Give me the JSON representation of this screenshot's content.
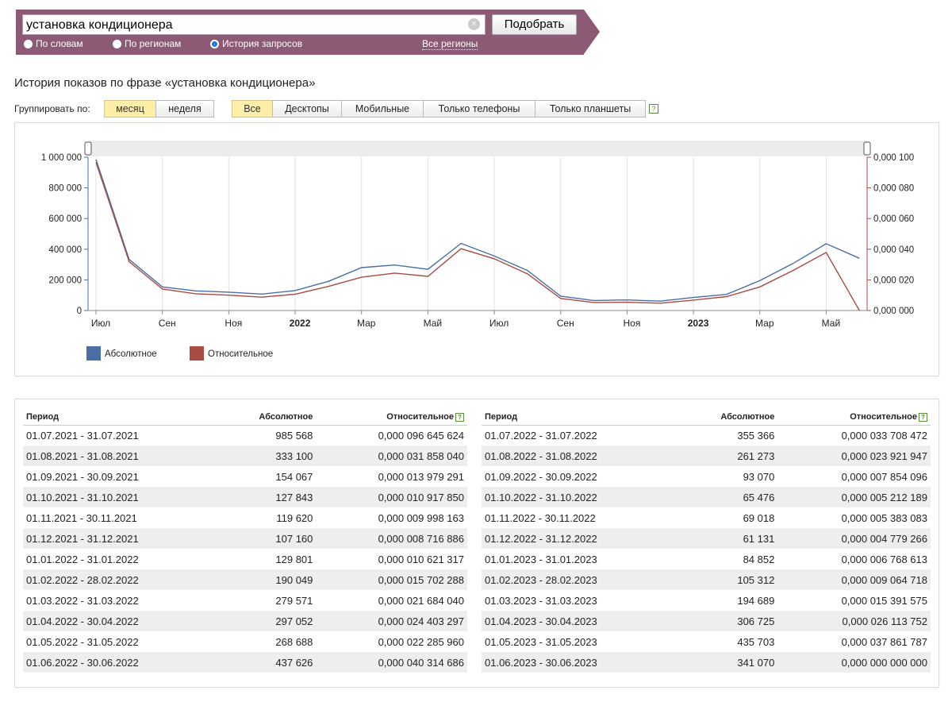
{
  "search": {
    "query": "установка кондиционера",
    "clear_icon": "clear-icon",
    "submit_label": "Подобрать",
    "modes": [
      {
        "label": "По словам",
        "selected": false
      },
      {
        "label": "По регионам",
        "selected": false
      },
      {
        "label": "История запросов",
        "selected": true
      }
    ],
    "regions_link": "Все регионы"
  },
  "page_title": "История показов по фразе «установка кондиционера»",
  "grouping": {
    "label": "Группировать по:",
    "options": [
      "месяц",
      "неделя"
    ],
    "selected": "месяц"
  },
  "devices": {
    "options": [
      "Все",
      "Десктопы",
      "Мобильные",
      "Только телефоны",
      "Только планшеты"
    ],
    "selected": "Все",
    "help_icon": "?"
  },
  "colors": {
    "header_bg": "#8c5a74",
    "absolute": "#4a6fa5",
    "relative": "#a84b43",
    "active_segment": "#fdeea8"
  },
  "chart_data": {
    "type": "line",
    "x_labels": [
      "Июл",
      "Сен",
      "Ноя",
      "2022",
      "Мар",
      "Май",
      "Июл",
      "Сен",
      "Ноя",
      "2023",
      "Мар",
      "Май"
    ],
    "left_axis_ticks": [
      "1 000 000",
      "800 000",
      "600 000",
      "400 000",
      "200 000",
      "0"
    ],
    "right_axis_ticks": [
      "0,000 100",
      "0,000 080",
      "0,000 060",
      "0,000 040",
      "0,000 020",
      "0,000 000"
    ],
    "left_ylim": [
      0,
      1000000
    ],
    "right_ylim": [
      0,
      0.0001
    ],
    "series": [
      {
        "name": "Абсолютное",
        "axis": "left",
        "values": [
          985568,
          333100,
          154067,
          127843,
          119620,
          107160,
          129801,
          190049,
          279571,
          297052,
          268688,
          437626,
          355366,
          261273,
          93070,
          65476,
          69018,
          61131,
          84852,
          105312,
          194689,
          306725,
          435703,
          341070
        ]
      },
      {
        "name": "Относительное",
        "axis": "right",
        "values": [
          9.6645624e-05,
          3.185804e-05,
          1.3979291e-05,
          1.091785e-05,
          9.998163e-06,
          8.716886e-06,
          1.0621317e-05,
          1.5702288e-05,
          2.168404e-05,
          2.4403297e-05,
          2.228596e-05,
          4.0314686e-05,
          3.3708472e-05,
          2.3921947e-05,
          7.854096e-06,
          5.212189e-06,
          5.383083e-06,
          4.779266e-06,
          6.768613e-06,
          9.064718e-06,
          1.5391575e-05,
          2.6113752e-05,
          3.7861787e-05,
          0.0
        ]
      }
    ]
  },
  "table": {
    "headers": {
      "period": "Период",
      "absolute": "Абсолютное",
      "relative": "Относительное"
    },
    "left_rows": [
      {
        "period": "01.07.2021 - 31.07.2021",
        "absolute": "985 568",
        "relative": "0,000 096 645 624"
      },
      {
        "period": "01.08.2021 - 31.08.2021",
        "absolute": "333 100",
        "relative": "0,000 031 858 040"
      },
      {
        "period": "01.09.2021 - 30.09.2021",
        "absolute": "154 067",
        "relative": "0,000 013 979 291"
      },
      {
        "period": "01.10.2021 - 31.10.2021",
        "absolute": "127 843",
        "relative": "0,000 010 917 850"
      },
      {
        "period": "01.11.2021 - 30.11.2021",
        "absolute": "119 620",
        "relative": "0,000 009 998 163"
      },
      {
        "period": "01.12.2021 - 31.12.2021",
        "absolute": "107 160",
        "relative": "0,000 008 716 886"
      },
      {
        "period": "01.01.2022 - 31.01.2022",
        "absolute": "129 801",
        "relative": "0,000 010 621 317"
      },
      {
        "period": "01.02.2022 - 28.02.2022",
        "absolute": "190 049",
        "relative": "0,000 015 702 288"
      },
      {
        "period": "01.03.2022 - 31.03.2022",
        "absolute": "279 571",
        "relative": "0,000 021 684 040"
      },
      {
        "period": "01.04.2022 - 30.04.2022",
        "absolute": "297 052",
        "relative": "0,000 024 403 297"
      },
      {
        "period": "01.05.2022 - 31.05.2022",
        "absolute": "268 688",
        "relative": "0,000 022 285 960"
      },
      {
        "period": "01.06.2022 - 30.06.2022",
        "absolute": "437 626",
        "relative": "0,000 040 314 686"
      }
    ],
    "right_rows": [
      {
        "period": "01.07.2022 - 31.07.2022",
        "absolute": "355 366",
        "relative": "0,000 033 708 472"
      },
      {
        "period": "01.08.2022 - 31.08.2022",
        "absolute": "261 273",
        "relative": "0,000 023 921 947"
      },
      {
        "period": "01.09.2022 - 30.09.2022",
        "absolute": "93 070",
        "relative": "0,000 007 854 096"
      },
      {
        "period": "01.10.2022 - 31.10.2022",
        "absolute": "65 476",
        "relative": "0,000 005 212 189"
      },
      {
        "period": "01.11.2022 - 30.11.2022",
        "absolute": "69 018",
        "relative": "0,000 005 383 083"
      },
      {
        "period": "01.12.2022 - 31.12.2022",
        "absolute": "61 131",
        "relative": "0,000 004 779 266"
      },
      {
        "period": "01.01.2023 - 31.01.2023",
        "absolute": "84 852",
        "relative": "0,000 006 768 613"
      },
      {
        "period": "01.02.2023 - 28.02.2023",
        "absolute": "105 312",
        "relative": "0,000 009 064 718"
      },
      {
        "period": "01.03.2023 - 31.03.2023",
        "absolute": "194 689",
        "relative": "0,000 015 391 575"
      },
      {
        "period": "01.04.2023 - 30.04.2023",
        "absolute": "306 725",
        "relative": "0,000 026 113 752"
      },
      {
        "period": "01.05.2023 - 31.05.2023",
        "absolute": "435 703",
        "relative": "0,000 037 861 787"
      },
      {
        "period": "01.06.2023 - 30.06.2023",
        "absolute": "341 070",
        "relative": "0,000 000 000 000"
      }
    ]
  }
}
